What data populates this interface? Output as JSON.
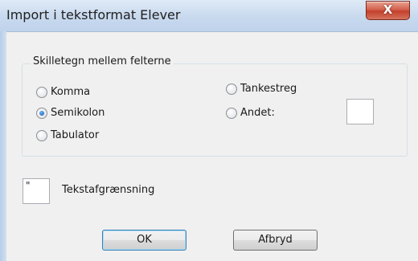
{
  "window": {
    "title": "Import i tekstformat Elever",
    "close_glyph": "X"
  },
  "separator_group": {
    "legend": "Skilletegn mellem felterne",
    "options": [
      {
        "label": "Komma",
        "selected": false
      },
      {
        "label": "Semikolon",
        "selected": true
      },
      {
        "label": "Tabulator",
        "selected": false
      },
      {
        "label": "Tankestreg",
        "selected": false
      },
      {
        "label": "Andet:",
        "selected": false
      }
    ],
    "other_value": ""
  },
  "text_qualifier": {
    "value": "\"",
    "label": "Tekstafgrænsning"
  },
  "buttons": {
    "ok": "OK",
    "cancel": "Afbryd"
  },
  "colors": {
    "titlebar": "#c8d9ee",
    "close": "#c3402c",
    "dialog_bg": "#f0f0f0",
    "default_button_border": "#3c7fb1"
  }
}
